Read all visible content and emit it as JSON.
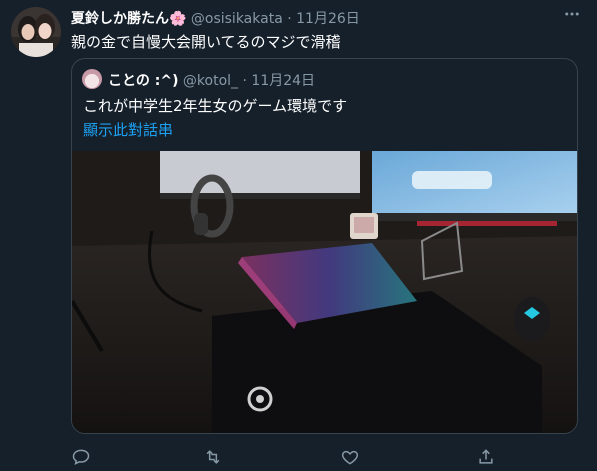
{
  "tweet": {
    "display_name": "夏鈴しか勝たん",
    "name_emoji": "🌸",
    "handle": "@osisikakata",
    "separator": "·",
    "date": "11月26日",
    "text": "親の金で自慢大会開いてるのマジで滑稽",
    "avatar_icon": "user-avatar",
    "more_icon": "more-options-icon"
  },
  "quoted": {
    "display_name": "ことの :^)",
    "handle": "@kotol_",
    "separator": "·",
    "date": "11月24日",
    "text": "これが中学生2年生女のゲーム環境です",
    "thread_link": "顯示此對話串",
    "photo": "gaming-desk-photo"
  },
  "actions": {
    "reply": "reply-icon",
    "retweet": "retweet-icon",
    "like": "like-icon",
    "share": "share-icon"
  },
  "colors": {
    "background": "#15202b",
    "border": "#38444d",
    "muted": "#8899a6",
    "link": "#1da1f2"
  }
}
